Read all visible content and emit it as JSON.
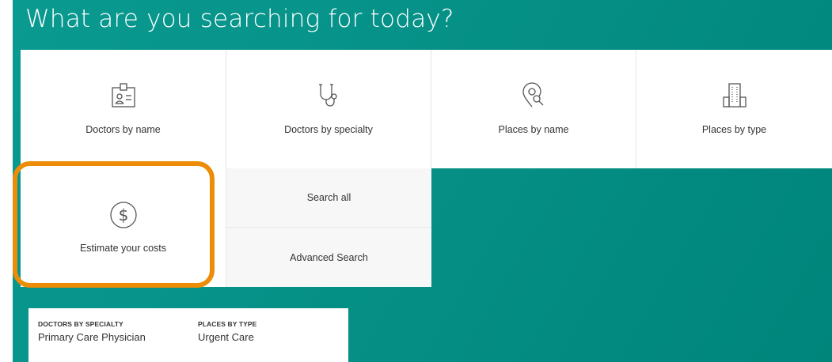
{
  "heading": "What are you searching for today?",
  "tiles": [
    {
      "label": "Doctors by name",
      "icon": "id-card-icon"
    },
    {
      "label": "Doctors by specialty",
      "icon": "stethoscope-icon"
    },
    {
      "label": "Places by name",
      "icon": "map-pin-search-icon"
    },
    {
      "label": "Places by type",
      "icon": "building-icon"
    }
  ],
  "estimate": {
    "label": "Estimate your costs",
    "icon": "dollar-circle-icon"
  },
  "side_links": {
    "search_all": "Search all",
    "advanced_search": "Advanced Search"
  },
  "quick_searches": [
    {
      "category": "DOCTORS BY SPECIALTY",
      "value": "Primary Care Physician"
    },
    {
      "category": "PLACES BY TYPE",
      "value": "Urgent Care"
    }
  ],
  "colors": {
    "background_teal": "#00857b",
    "highlight_orange": "#ec8c07",
    "icon_gray": "#555555"
  }
}
